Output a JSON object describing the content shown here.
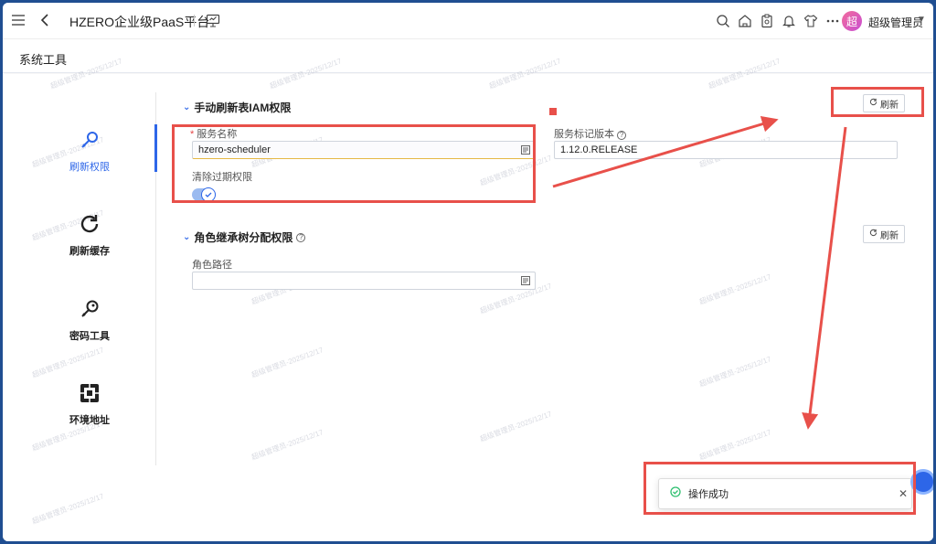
{
  "topbar": {
    "app_title": "HZERO企业级PaaS平台",
    "user_avatar_text": "超",
    "user_name": "超级管理员"
  },
  "page": {
    "title": "系统工具"
  },
  "sidenav": {
    "items": [
      {
        "label": "刷新权限",
        "icon": "key-search-icon"
      },
      {
        "label": "刷新缓存",
        "icon": "refresh-icon"
      },
      {
        "label": "密码工具",
        "icon": "key-icon"
      },
      {
        "label": "环境地址",
        "icon": "environment-icon"
      }
    ]
  },
  "section1": {
    "title": "手动刷新表IAM权限",
    "service_name_label": "服务名称",
    "service_name_value": "hzero-scheduler",
    "clear_expired_label": "清除过期权限",
    "service_version_label": "服务标记版本",
    "service_version_value": "1.12.0.RELEASE",
    "refresh_label": "刷新"
  },
  "section2": {
    "title": "角色继承树分配权限",
    "role_path_label": "角色路径",
    "role_path_value": "",
    "refresh_label": "刷新"
  },
  "toast": {
    "message": "操作成功"
  },
  "watermark": {
    "text": "超级管理员-2025/12/17"
  },
  "colors": {
    "accent": "#2d66e8",
    "annotation": "#e8504a",
    "success": "#2ebf6f"
  }
}
